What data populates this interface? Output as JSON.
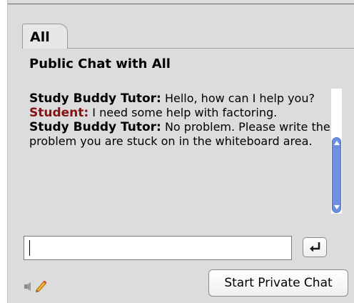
{
  "tabs": [
    {
      "label": "All"
    }
  ],
  "chat": {
    "title": "Public Chat with All",
    "messages": [
      {
        "sender": "Study Buddy Tutor:",
        "text": " Hello, how can I help you?",
        "role": "tutor"
      },
      {
        "sender": "Student:",
        "text": " I need some help with factoring.",
        "role": "student"
      },
      {
        "sender": "Study Buddy Tutor:",
        "text": " No problem.  Please write the problem you are stuck on in the whiteboard area.",
        "role": "tutor"
      }
    ]
  },
  "input": {
    "value": "",
    "placeholder": ""
  },
  "icons": {
    "send": "enter-arrow-icon",
    "sound": "speaker-icon",
    "pen": "pen-icon"
  },
  "buttons": {
    "private_chat": "Start Private Chat"
  },
  "colors": {
    "panel_bg": "#dcdcdc",
    "student_name": "#8b1010",
    "scroll_thumb": "#6f8fe0"
  }
}
